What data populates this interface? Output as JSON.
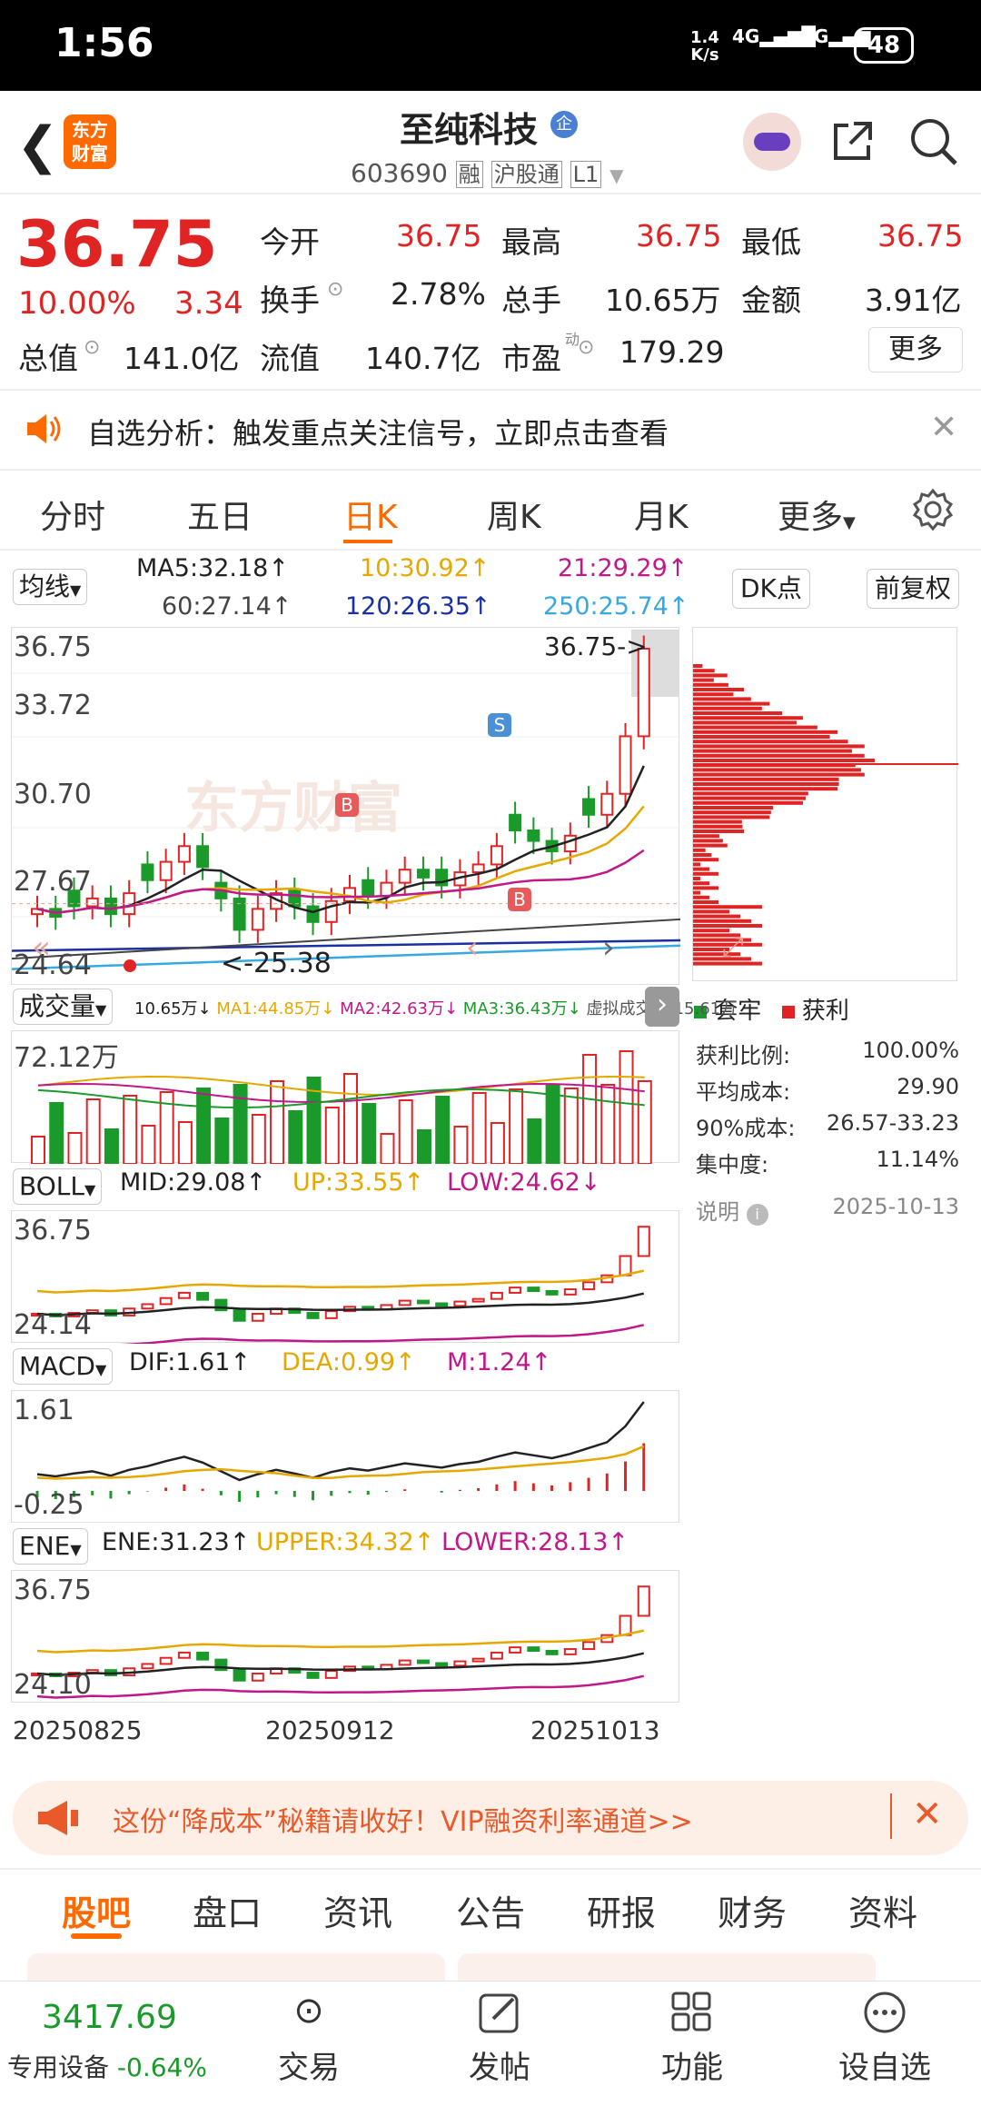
{
  "status": {
    "time": "1:56",
    "net_speed": "1.4",
    "net_unit": "K/s",
    "sig1": "4G",
    "sig2": "4G",
    "battery": "48"
  },
  "header": {
    "logo_line1": "东方",
    "logo_line2": "财富",
    "stock_name": "至纯科技",
    "badge": "企",
    "code": "603690",
    "tag1": "融",
    "tag2": "沪股通",
    "tag3": "L1"
  },
  "quote": {
    "price": "36.75",
    "pct": "10.00%",
    "change": "3.34",
    "row1": {
      "l1": "今开",
      "v1": "36.75",
      "l2": "最高",
      "v2": "36.75",
      "l3": "最低",
      "v3": "36.75"
    },
    "row2": {
      "l1": "换手",
      "v1": "2.78%",
      "l2": "总手",
      "v2": "10.65万",
      "l3": "金额",
      "v3": "3.91亿"
    },
    "row3": {
      "l1": "总值",
      "v1": "141.0亿",
      "l2": "流值",
      "v2": "140.7亿",
      "l3": "市盈",
      "sup": "动",
      "v3": "179.29"
    },
    "more": "更多"
  },
  "notice": {
    "text": "自选分析：触发重点关注信号，立即点击查看"
  },
  "tabs": [
    "分时",
    "五日",
    "日K",
    "周K",
    "月K",
    "更多"
  ],
  "ma_legend": {
    "btn": "均线",
    "ma5": "MA5:32.18↑",
    "ma10": "10:30.92↑",
    "ma21": "21:29.29↑",
    "ma60": "60:27.14↑",
    "ma120": "120:26.35↑",
    "ma250": "250:25.74↑",
    "dk": "DK点",
    "fq": "前复权"
  },
  "kchart": {
    "y1": "36.75",
    "y2": "33.72",
    "y3": "30.70",
    "y4": "27.67",
    "y5": "24.64",
    "high_label": "36.75->",
    "low_label": "<-25.38",
    "watermark": "东方财富",
    "s": "S",
    "b": "B"
  },
  "volume": {
    "btn": "成交量",
    "legend": "10.65万↓",
    "ma1": "MA1:44.85万↓",
    "ma2": "MA2:42.63万↓",
    "ma3": "MA3:36.43万↓",
    "virtual": "虚拟成交量:15.61万",
    "ymax": "72.12万"
  },
  "boll": {
    "btn": "BOLL",
    "mid": "MID:29.08↑",
    "up": "UP:33.55↑",
    "low": "LOW:24.62↓",
    "ymax": "36.75",
    "ymin": "24.14"
  },
  "macd": {
    "btn": "MACD",
    "dif": "DIF:1.61↑",
    "dea": "DEA:0.99↑",
    "m": "M:1.24↑",
    "ymax": "1.61",
    "ymin": "-0.25"
  },
  "ene": {
    "btn": "ENE",
    "ene": "ENE:31.23↑",
    "upper": "UPPER:34.32↑",
    "lower": "LOWER:28.13↑",
    "ymax": "36.75",
    "ymin": "24.10"
  },
  "dates": [
    "20250825",
    "20250912",
    "20251013"
  ],
  "chip": {
    "legend1": "套牢",
    "legend2": "获利",
    "rows": [
      {
        "k": "获利比例:",
        "v": "100.00%"
      },
      {
        "k": "平均成本:",
        "v": "29.90"
      },
      {
        "k": "90%成本:",
        "v": "26.57-33.23"
      },
      {
        "k": "集中度:",
        "v": "11.14%"
      },
      {
        "k": "说明",
        "v": "2025-10-13"
      }
    ]
  },
  "promo": {
    "text": "这份“降成本”秘籍请收好！VIP融资利率通道>>"
  },
  "bottom_tabs": [
    "股吧",
    "盘口",
    "资讯",
    "公告",
    "研报",
    "财务",
    "资料"
  ],
  "nav": {
    "index_value": "3417.69",
    "index_name": "专用设备",
    "index_pct": "-0.64%",
    "trade": "交易",
    "post": "发帖",
    "func": "功能",
    "fav": "设自选"
  },
  "colors": {
    "up": "#e02424",
    "down": "#1a9a2a",
    "accent": "#ff6a00"
  }
}
